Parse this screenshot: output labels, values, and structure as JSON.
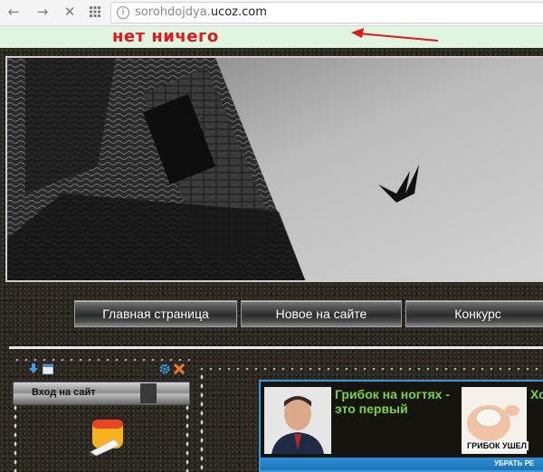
{
  "browser": {
    "url_domain_prefix": "sorohdojdya.",
    "url_domain_main": "ucoz.com",
    "back_glyph": "←",
    "forward_glyph": "→",
    "stop_glyph": "✕",
    "info_glyph": "i"
  },
  "annotation": {
    "text": "нет ничего",
    "color": "#e8141b"
  },
  "menu": {
    "items": [
      {
        "label": "Главная страница"
      },
      {
        "label": "Новое на сайте"
      },
      {
        "label": "Конкурс"
      }
    ]
  },
  "sidebar": {
    "login_label": "Вход на сайт"
  },
  "ad": {
    "title_1": "Грибок на ногтях - это первый",
    "title_2": "Хо",
    "caption": "ГРИБОК УШЕЛ",
    "close_label": "УБРАТЬ РЕ",
    "accent_color": "#7ed23a",
    "border_color": "#3a9ad8"
  }
}
